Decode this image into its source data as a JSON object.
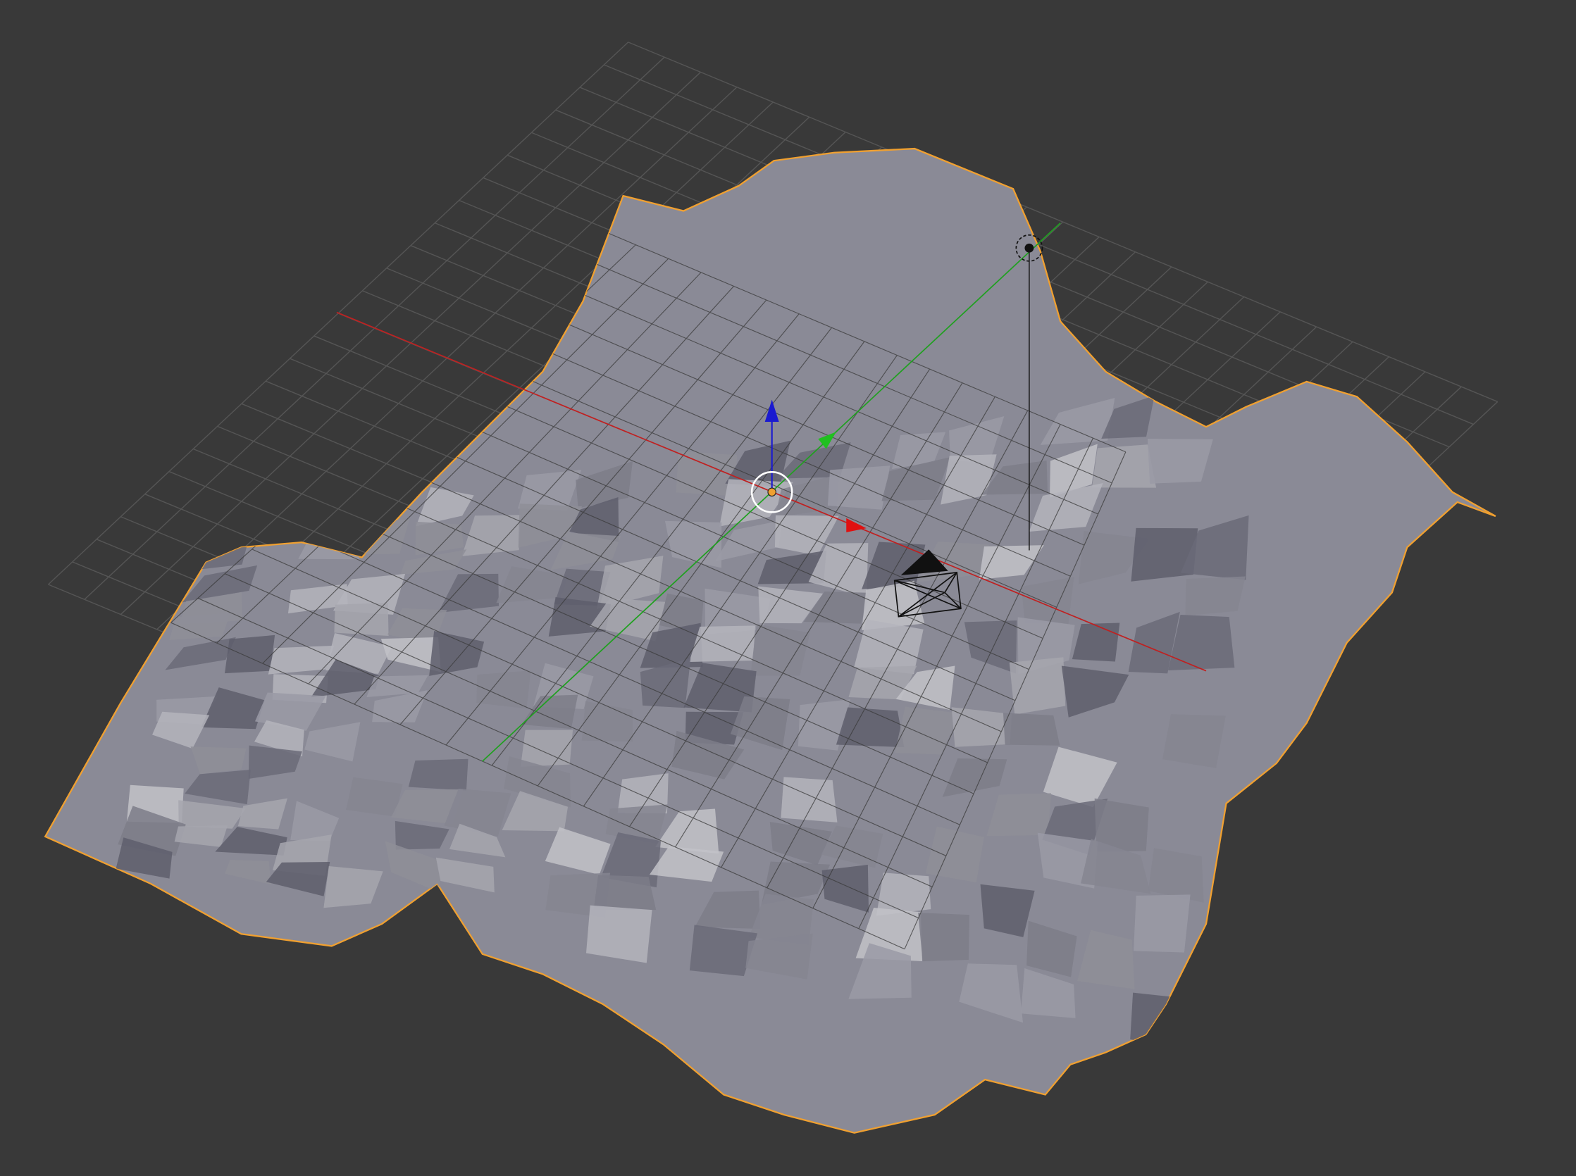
{
  "viewport": {
    "background": "#393939",
    "selection_outline_color": "#f0a030",
    "x_axis_color": "#c02020",
    "y_axis_color": "#20a020",
    "z_axis_color": "#1a1ad0",
    "mesh_base_color": "#8a8a96",
    "grid_color": "#555555"
  },
  "objects": [
    {
      "name": "terrain-mesh",
      "selected": true
    },
    {
      "name": "camera",
      "selected": false
    },
    {
      "name": "lamp",
      "selected": false
    }
  ]
}
